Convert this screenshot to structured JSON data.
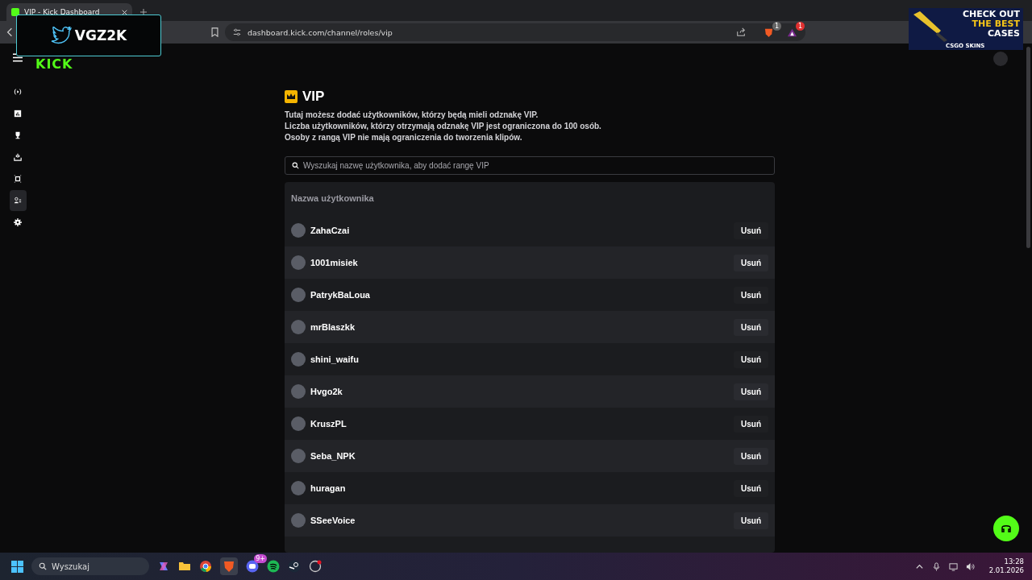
{
  "browser": {
    "tab_title": "VIP - Kick Dashboard",
    "url": "dashboard.kick.com/channel/roles/vip",
    "extension_badges": [
      "1",
      "1"
    ]
  },
  "overlay": {
    "handle": "VGZ2K",
    "ad_lines": [
      "CHECK OUT",
      "THE BEST",
      "CASES"
    ],
    "ad_brand": "CSGO SKINS"
  },
  "sidebar": {
    "logo": "KICK",
    "items": [
      {
        "kind": "stream",
        "selected": false
      },
      {
        "kind": "analytics",
        "selected": false
      },
      {
        "kind": "trophy",
        "selected": false
      },
      {
        "kind": "upload",
        "selected": false
      },
      {
        "kind": "clip",
        "selected": false
      },
      {
        "kind": "roles",
        "selected": true
      },
      {
        "kind": "settings",
        "selected": false
      }
    ]
  },
  "page": {
    "title": "VIP",
    "description": [
      "Tutaj możesz dodać użytkowników, którzy będą mieli odznakę VIP.",
      "Liczba użytkowników, którzy otrzymają odznakę VIP jest ograniczona do 100 osób.",
      "Osoby z rangą VIP nie mają ograniczenia do tworzenia klipów."
    ],
    "search": {
      "placeholder": "Wyszukaj nazwę użytkownika, aby dodać rangę VIP"
    },
    "table": {
      "columns": [
        "Nazwa użytkownika"
      ],
      "rows": [
        {
          "username": "ZahaCzai",
          "action": "Usuń"
        },
        {
          "username": "1001misiek",
          "action": "Usuń"
        },
        {
          "username": "PatrykBaLoua",
          "action": "Usuń"
        },
        {
          "username": "mrBlaszkk",
          "action": "Usuń"
        },
        {
          "username": "shini_waifu",
          "action": "Usuń"
        },
        {
          "username": "Hvgo2k",
          "action": "Usuń"
        },
        {
          "username": "KruszPL",
          "action": "Usuń"
        },
        {
          "username": "Seba_NPK",
          "action": "Usuń"
        },
        {
          "username": "huragan",
          "action": "Usuń"
        },
        {
          "username": "SSeeVoice",
          "action": "Usuń"
        }
      ]
    }
  },
  "taskbar": {
    "search_placeholder": "Wyszukaj",
    "discord_badge": "9+",
    "time": "13:28",
    "date": "2.01.2026"
  }
}
